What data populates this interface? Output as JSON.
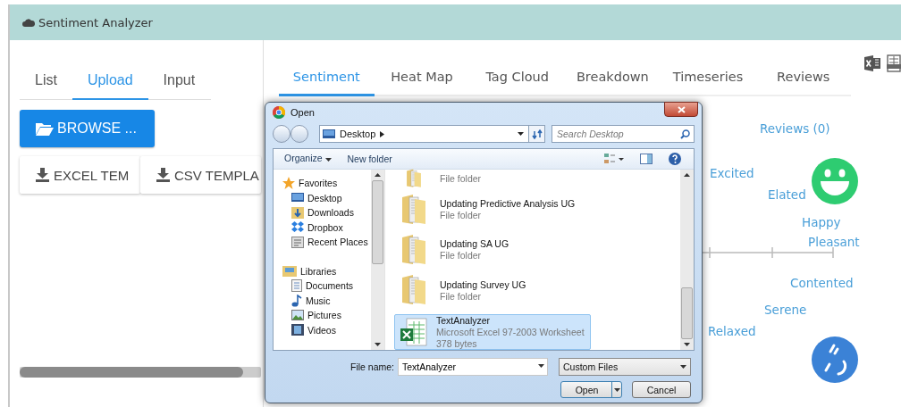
{
  "app": {
    "title": "Sentiment Analyzer"
  },
  "left_tabs": [
    {
      "label": "List",
      "selected": false
    },
    {
      "label": "Upload",
      "selected": true
    },
    {
      "label": "Input",
      "selected": false
    }
  ],
  "browse_button": "BROWSE ...",
  "template_buttons": [
    "EXCEL TEM",
    "CSV TEMPLA"
  ],
  "right_tabs": [
    {
      "label": "Sentiment",
      "selected": true
    },
    {
      "label": "Heat Map",
      "selected": false
    },
    {
      "label": "Tag Cloud",
      "selected": false
    },
    {
      "label": "Breakdown",
      "selected": false
    },
    {
      "label": "Timeseries",
      "selected": false
    },
    {
      "label": "Reviews",
      "selected": false
    }
  ],
  "sentiment": {
    "reviews": "Reviews (0)",
    "labels": [
      "Excited",
      "Elated",
      "Happy",
      "Pleasant",
      "Contented",
      "Serene",
      "Relaxed"
    ]
  },
  "dialog": {
    "title": "Open",
    "path": "Desktop",
    "search_placeholder": "Search Desktop",
    "toolbar": [
      "Organize",
      "New folder"
    ],
    "nav": [
      {
        "label": "Favorites",
        "kind": "star",
        "children": [
          {
            "label": "Desktop",
            "kind": "desktop"
          },
          {
            "label": "Downloads",
            "kind": "downloads"
          },
          {
            "label": "Dropbox",
            "kind": "dropbox"
          },
          {
            "label": "Recent Places",
            "kind": "recent"
          }
        ]
      },
      {
        "label": "Libraries",
        "kind": "libraries",
        "children": [
          {
            "label": "Documents",
            "kind": "documents"
          },
          {
            "label": "Music",
            "kind": "music"
          },
          {
            "label": "Pictures",
            "kind": "pictures"
          },
          {
            "label": "Videos",
            "kind": "videos"
          }
        ]
      }
    ],
    "files": [
      {
        "kind": "folder",
        "type": "File folder",
        "selected": false
      },
      {
        "kind": "folder",
        "name": "Updating Predictive Analysis UG",
        "type": "File folder",
        "selected": false
      },
      {
        "kind": "folder",
        "name": "Updating SA UG",
        "type": "File folder",
        "selected": false
      },
      {
        "kind": "folder",
        "name": "Updating Survey UG",
        "type": "File folder",
        "selected": false
      },
      {
        "kind": "excel",
        "name": "TextAnalyzer",
        "type": "Microsoft Excel 97-2003 Worksheet",
        "size": "378 bytes",
        "selected": true
      }
    ],
    "file_name_label": "File name:",
    "file_name": "TextAnalyzer",
    "filter": "Custom Files",
    "buttons": [
      "Open",
      "Cancel"
    ]
  }
}
